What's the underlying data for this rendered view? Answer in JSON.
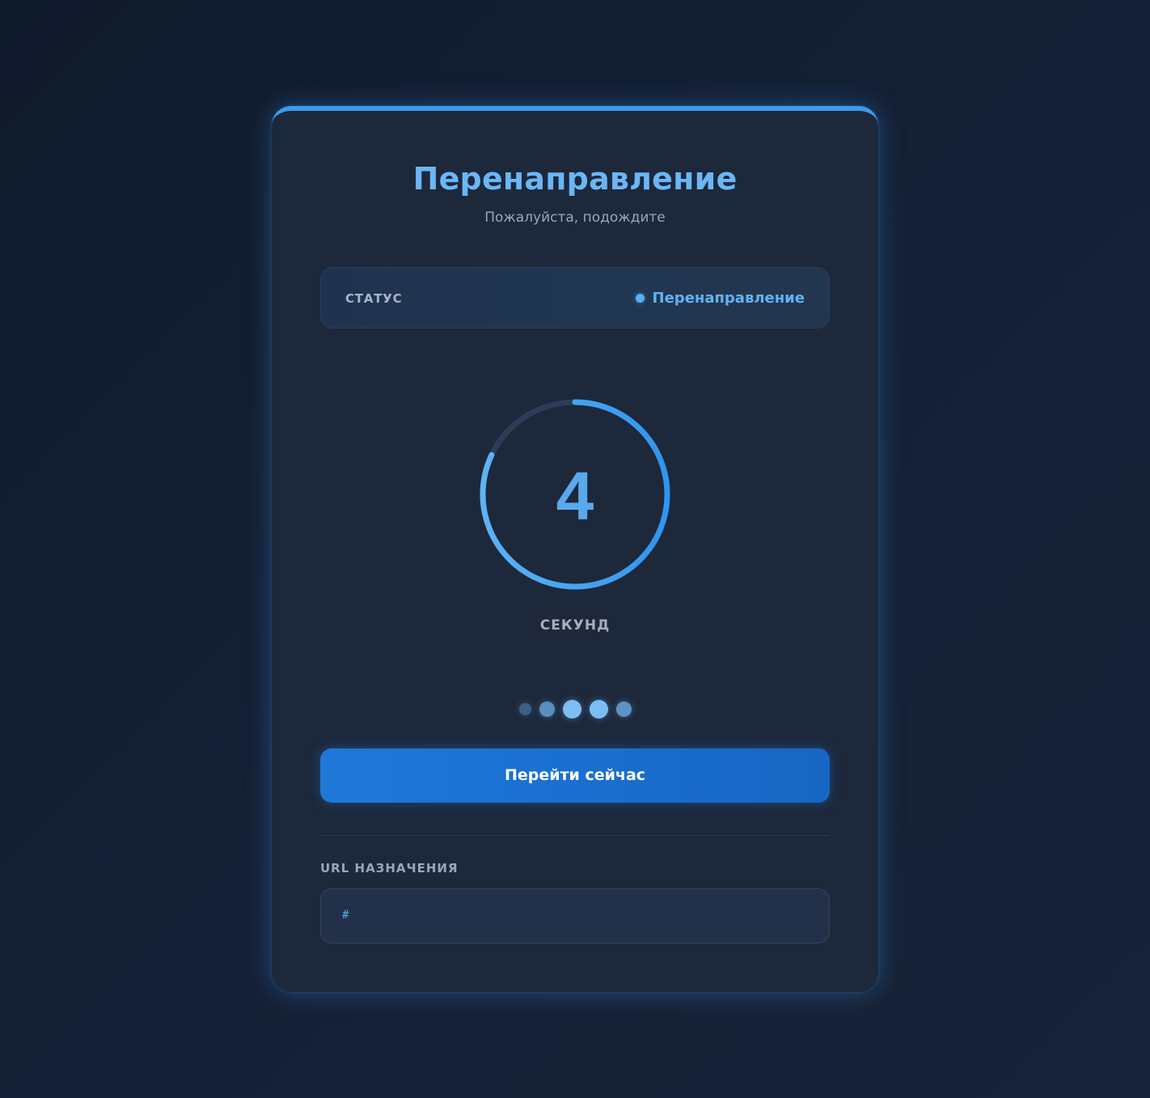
{
  "page": {
    "title": "Перенаправление",
    "subtitle": "Пожалуйста, подождите"
  },
  "status": {
    "label": "СТАТУС",
    "value": "Перенаправление"
  },
  "countdown": {
    "value": "4",
    "unit_label": "СЕКУНД",
    "progress_fraction": 0.82
  },
  "loading_dots": {
    "count": 5
  },
  "actions": {
    "go_now_label": "Перейти сейчас"
  },
  "destination": {
    "label": "URL НАЗНАЧЕНИЯ",
    "url": "#"
  },
  "colors": {
    "accent": "#3b9bf0",
    "title": "#6bb6f5",
    "button": "#1f78d8",
    "background": "#142035",
    "card": "#1d283b"
  }
}
